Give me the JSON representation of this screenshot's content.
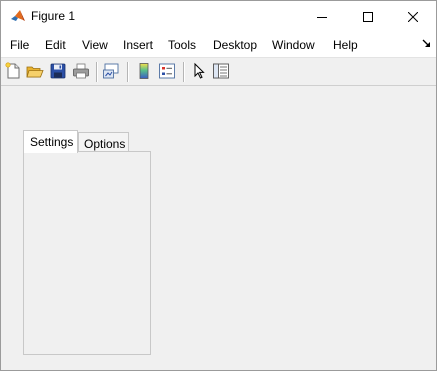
{
  "window": {
    "title": "Figure 1"
  },
  "menubar": {
    "items": [
      "File",
      "Edit",
      "View",
      "Insert",
      "Tools",
      "Desktop",
      "Window",
      "Help"
    ]
  },
  "toolbar": {
    "buttons": [
      "new-figure-icon",
      "open-file-icon",
      "save-icon",
      "print-icon",
      "link-plot-icon",
      "colorbar-icon",
      "legend-icon",
      "edit-plot-icon",
      "property-inspector-icon"
    ]
  },
  "tabs": {
    "items": [
      {
        "label": "Settings",
        "selected": true
      },
      {
        "label": "Options",
        "selected": false
      }
    ]
  }
}
